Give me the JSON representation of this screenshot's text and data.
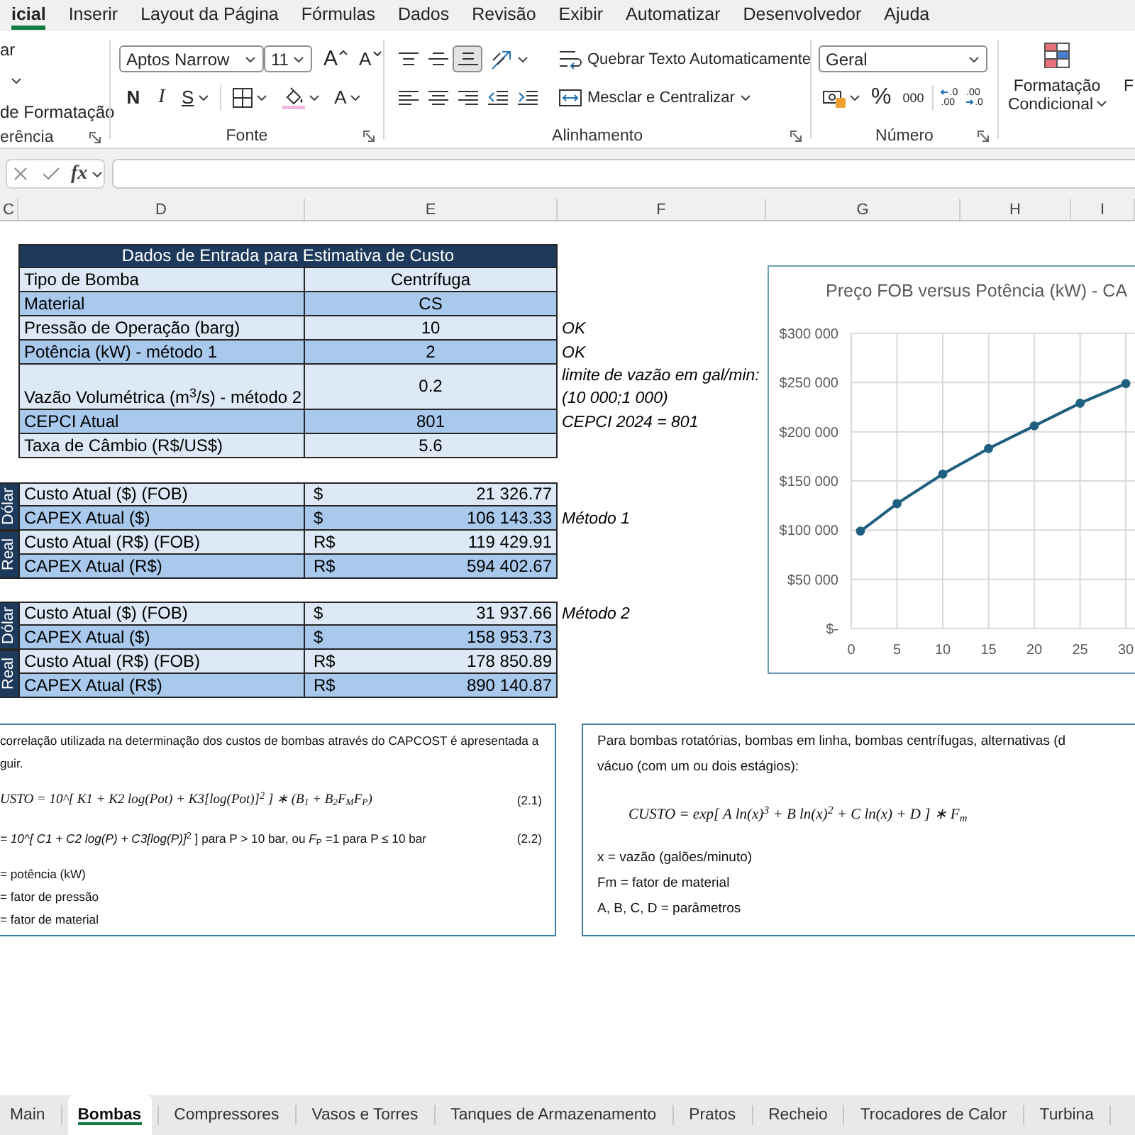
{
  "ribbon_tabs": [
    {
      "label": "icial",
      "selected": true
    },
    {
      "label": "Inserir",
      "selected": false
    },
    {
      "label": "Layout da Página",
      "selected": false
    },
    {
      "label": "Fórmulas",
      "selected": false
    },
    {
      "label": "Dados",
      "selected": false
    },
    {
      "label": "Revisão",
      "selected": false
    },
    {
      "label": "Exibir",
      "selected": false
    },
    {
      "label": "Automatizar",
      "selected": false
    },
    {
      "label": "Desenvolvedor",
      "selected": false
    },
    {
      "label": "Ajuda",
      "selected": false
    }
  ],
  "ribbon": {
    "clipboard": {
      "cut_label": "ar",
      "format_painter_label": "de Formatação",
      "group_label": "erência"
    },
    "font": {
      "font_name": "Aptos Narrow",
      "font_size": "11",
      "grow_label": "A",
      "shrink_label": "A",
      "bold_label": "N",
      "italic_label": "I",
      "underline_label": "S",
      "font_color_label": "A",
      "group_label": "Fonte"
    },
    "alignment": {
      "vertical_buttons": [
        {
          "kind": "top",
          "selected": false
        },
        {
          "kind": "middle",
          "selected": false
        },
        {
          "kind": "bottom",
          "selected": true
        }
      ],
      "wrap_text_label": "Quebrar Texto Automaticamente",
      "merge_label": "Mesclar e Centralizar",
      "group_label": "Alinhamento"
    },
    "number": {
      "format": "Geral",
      "percent_label": "%",
      "thousands_label": "000",
      "decrease_decimal": [
        ".0",
        ".00"
      ],
      "increase_decimal": [
        ".00",
        ".0"
      ],
      "group_label": "Número"
    },
    "styles": {
      "conditional_formatting_label": "Formatação Condicional",
      "next_label": "F"
    }
  },
  "formula_bar": {
    "function_label": "fx"
  },
  "column_headers": [
    "C",
    "D",
    "E",
    "F",
    "G",
    "H",
    "I"
  ],
  "input_table": {
    "title": "Dados de Entrada para Estimativa de Custo",
    "rows": [
      {
        "label": "Tipo de Bomba",
        "value": "Centrífuga"
      },
      {
        "label": "Material",
        "value": "CS"
      },
      {
        "label": "Pressão de Operação (barg)",
        "value": "10",
        "notes": [
          "OK"
        ]
      },
      {
        "label": "Potência (kW) - método 1",
        "value": "2",
        "notes": [
          "OK"
        ]
      },
      {
        "label": "Vazão Volumétrica (m$^{3}$/s) - método 2",
        "value": "0.2",
        "notes": [
          "limite de vazão em gal/min:",
          "(10 000;1 000)"
        ]
      },
      {
        "label": "CEPCI Atual",
        "value": "801",
        "notes": [
          "CEPCI 2024 = 801"
        ]
      },
      {
        "label": "Taxa de Câmbio (R$/US$)",
        "value": "5.6"
      }
    ]
  },
  "cost_tables": [
    {
      "groups": [
        {
          "label": "Dólar",
          "rows": [
            {
              "label": "Custo Atual ($) (FOB)",
              "currency": "$",
              "value": "21 326.77"
            },
            {
              "label": "CAPEX Atual ($)",
              "currency": "$",
              "value": "106 143.33",
              "note": "Método 1"
            }
          ]
        },
        {
          "label": "Real",
          "rows": [
            {
              "label": "Custo Atual (R$) (FOB)",
              "currency": "R$",
              "value": "119 429.91"
            },
            {
              "label": "CAPEX Atual (R$)",
              "currency": "R$",
              "value": "594 402.67"
            }
          ]
        }
      ]
    },
    {
      "groups": [
        {
          "label": "Dólar",
          "rows": [
            {
              "label": "Custo Atual ($) (FOB)",
              "currency": "$",
              "value": "31 937.66",
              "note": "Método 2"
            },
            {
              "label": "CAPEX Atual ($)",
              "currency": "$",
              "value": "158 953.73"
            }
          ]
        },
        {
          "label": "Real",
          "rows": [
            {
              "label": "Custo Atual (R$) (FOB)",
              "currency": "R$",
              "value": "178 850.89"
            },
            {
              "label": "CAPEX Atual (R$)",
              "currency": "R$",
              "value": "890 140.87"
            }
          ]
        }
      ]
    }
  ],
  "chart": {
    "chart_data": {
      "type": "line",
      "title": "Preço FOB versus Potência (kW) - CA",
      "x": [
        1,
        5,
        10,
        15,
        20,
        25,
        30
      ],
      "series": [
        {
          "color": "#1f5f7f",
          "marker": "circle",
          "values": [
            99000,
            127000,
            157000,
            183000,
            206000,
            229000,
            249000
          ]
        }
      ],
      "grid": true,
      "xlim": [
        0,
        31
      ],
      "ylim": [
        0,
        300000
      ],
      "xticks": [
        0,
        5,
        10,
        15,
        20,
        25,
        30
      ],
      "yticks": [
        {
          "value": 0,
          "label": "$-"
        },
        {
          "value": 50000,
          "label": "$50 000"
        },
        {
          "value": 100000,
          "label": "$100 000"
        },
        {
          "value": 150000,
          "label": "$150 000"
        },
        {
          "value": 200000,
          "label": "$200 000"
        },
        {
          "value": 250000,
          "label": "$250 000"
        },
        {
          "value": 300000,
          "label": "$300 000"
        }
      ]
    }
  },
  "text_boxes": [
    {
      "lines": [
        {
          "kind": "text",
          "text": "correlação utilizada na determinação dos custos de bombas através do CAPCOST é apresentada a"
        },
        {
          "kind": "text",
          "text": "guir."
        },
        {
          "kind": "formula",
          "text": "USTO = 10^[ K1 + K2 log(Pot) + K3[log(Pot)]$^{2}$ ] ∗ (B$_{1}$ + B$_{2}$F$_{M}$F$_{P}$)",
          "number": "(2.1)"
        },
        {
          "kind": "formula_text",
          "text": "*= 10^[ C1 + C2 log(P) + C3[log(P)]*$^{2}$ ] para P > 10 bar, ou *F*$_{P}$ =1 para P ≤ 10 bar",
          "number": "(2.2)"
        },
        {
          "kind": "text",
          "text": "= potência (kW)"
        },
        {
          "kind": "text",
          "text": "= fator de pressão"
        },
        {
          "kind": "text",
          "text": "= fator de material"
        }
      ]
    },
    {
      "lines": [
        {
          "kind": "text",
          "text": "Para bombas rotatórias, bombas em linha, bombas centrífugas, alternativas (d"
        },
        {
          "kind": "text",
          "text": "vácuo (com um ou dois estágios):"
        },
        {
          "kind": "formula",
          "text": "CUSTO = exp[ A ln(x)$^{3}$ + B ln(x)$^{2}$ + C ln(x) + D ] ∗ F$_{m}$"
        },
        {
          "kind": "text",
          "text": "x = vazão (galões/minuto)"
        },
        {
          "kind": "text",
          "text": "Fm = fator de material"
        },
        {
          "kind": "text",
          "text": "A, B, C, D = parâmetros"
        }
      ]
    }
  ],
  "sheet_tabs": [
    {
      "label": "Main",
      "selected": false
    },
    {
      "label": "Bombas",
      "selected": true
    },
    {
      "label": "Compressores",
      "selected": false
    },
    {
      "label": "Vasos e Torres",
      "selected": false
    },
    {
      "label": "Tanques de Armazenamento",
      "selected": false
    },
    {
      "label": "Pratos",
      "selected": false
    },
    {
      "label": "Recheio",
      "selected": false
    },
    {
      "label": "Trocadores de Calor",
      "selected": false
    },
    {
      "label": "Turbina",
      "selected": false
    }
  ]
}
